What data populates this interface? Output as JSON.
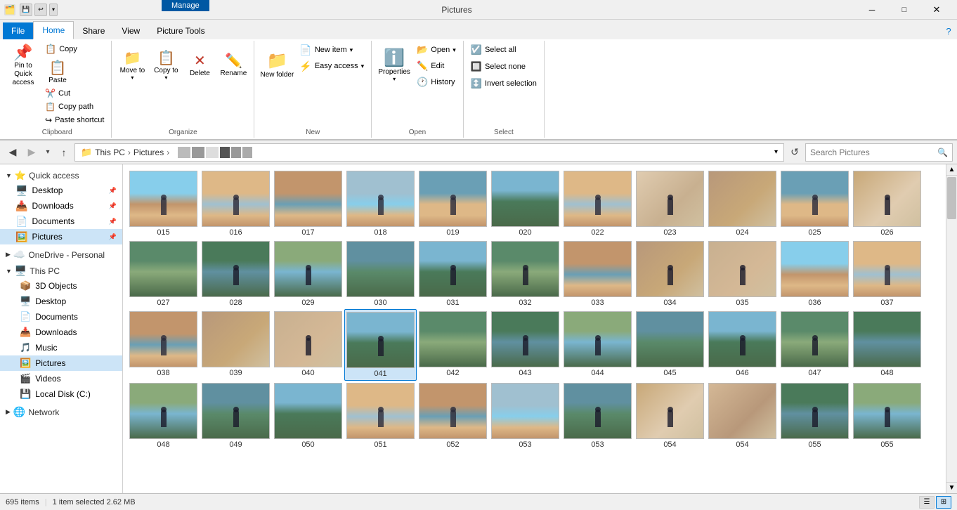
{
  "window": {
    "title": "Pictures",
    "manage_label": "Manage"
  },
  "titlebar": {
    "quicksave_label": "💾",
    "undo_label": "↩",
    "dropdown_label": "▾"
  },
  "ribbon": {
    "tabs": [
      "File",
      "Home",
      "Share",
      "View",
      "Picture Tools"
    ],
    "active_tab": "Home",
    "manage_tab": "Manage",
    "groups": {
      "clipboard": {
        "label": "Clipboard",
        "pin_label": "Pin to Quick access",
        "copy_label": "Copy",
        "paste_label": "Paste",
        "cut_label": "Cut",
        "copy_path_label": "Copy path",
        "paste_shortcut_label": "Paste shortcut"
      },
      "organize": {
        "label": "Organize",
        "move_to_label": "Move to",
        "copy_to_label": "Copy to",
        "delete_label": "Delete",
        "rename_label": "Rename"
      },
      "new": {
        "label": "New",
        "new_folder_label": "New folder",
        "new_item_label": "New item",
        "easy_access_label": "Easy access"
      },
      "open": {
        "label": "Open",
        "properties_label": "Properties",
        "open_label": "Open",
        "edit_label": "Edit",
        "history_label": "History"
      },
      "select": {
        "label": "Select",
        "select_all_label": "Select all",
        "select_none_label": "Select none",
        "invert_label": "Invert selection"
      }
    }
  },
  "address": {
    "path_parts": [
      "This PC",
      "Pictures"
    ],
    "search_placeholder": "Search Pictures"
  },
  "sidebar": {
    "quick_access_label": "Quick access",
    "items_quick": [
      {
        "label": "Desktop",
        "icon": "📁",
        "pinned": true
      },
      {
        "label": "Downloads",
        "icon": "📥",
        "pinned": true
      },
      {
        "label": "Documents",
        "icon": "📄",
        "pinned": true
      },
      {
        "label": "Pictures",
        "icon": "🖼️",
        "pinned": true,
        "active": true
      }
    ],
    "onedrive_label": "OneDrive - Personal",
    "this_pc_label": "This PC",
    "items_pc": [
      {
        "label": "3D Objects",
        "icon": "📦"
      },
      {
        "label": "Desktop",
        "icon": "🖥️"
      },
      {
        "label": "Documents",
        "icon": "📄"
      },
      {
        "label": "Downloads",
        "icon": "📥"
      },
      {
        "label": "Music",
        "icon": "🎵"
      },
      {
        "label": "Pictures",
        "icon": "🖼️",
        "active": true
      },
      {
        "label": "Videos",
        "icon": "🎬"
      },
      {
        "label": "Local Disk (C:)",
        "icon": "💾"
      }
    ],
    "network_label": "Network",
    "network_icon": "🌐"
  },
  "thumbnails": [
    {
      "id": "015",
      "type": "beach"
    },
    {
      "id": "016",
      "type": "beach"
    },
    {
      "id": "017",
      "type": "beach"
    },
    {
      "id": "018",
      "type": "beach"
    },
    {
      "id": "019",
      "type": "beach"
    },
    {
      "id": "020",
      "type": "outdoor"
    },
    {
      "id": "022",
      "type": "beach"
    },
    {
      "id": "023",
      "type": "indoor"
    },
    {
      "id": "024",
      "type": "indoor"
    },
    {
      "id": "025",
      "type": "beach"
    },
    {
      "id": "026",
      "type": "indoor"
    },
    {
      "id": "027",
      "type": "outdoor"
    },
    {
      "id": "028",
      "type": "outdoor"
    },
    {
      "id": "029",
      "type": "outdoor"
    },
    {
      "id": "030",
      "type": "outdoor"
    },
    {
      "id": "031",
      "type": "outdoor"
    },
    {
      "id": "032",
      "type": "outdoor"
    },
    {
      "id": "033",
      "type": "beach"
    },
    {
      "id": "034",
      "type": "indoor"
    },
    {
      "id": "035",
      "type": "indoor"
    },
    {
      "id": "036",
      "type": "beach"
    },
    {
      "id": "037",
      "type": "beach"
    },
    {
      "id": "038",
      "type": "beach"
    },
    {
      "id": "039",
      "type": "indoor"
    },
    {
      "id": "040",
      "type": "indoor"
    },
    {
      "id": "041",
      "type": "outdoor",
      "selected": true
    },
    {
      "id": "042",
      "type": "outdoor"
    },
    {
      "id": "043",
      "type": "outdoor"
    },
    {
      "id": "044",
      "type": "outdoor"
    },
    {
      "id": "045",
      "type": "outdoor"
    },
    {
      "id": "046",
      "type": "outdoor"
    },
    {
      "id": "047",
      "type": "outdoor"
    },
    {
      "id": "048",
      "type": "outdoor"
    },
    {
      "id": "048b",
      "type": "outdoor",
      "label": "048"
    },
    {
      "id": "049",
      "type": "outdoor"
    },
    {
      "id": "050",
      "type": "outdoor"
    },
    {
      "id": "051",
      "type": "beach"
    },
    {
      "id": "052",
      "type": "beach"
    },
    {
      "id": "053",
      "type": "beach"
    },
    {
      "id": "053b",
      "type": "outdoor",
      "label": "053"
    },
    {
      "id": "054",
      "type": "indoor"
    },
    {
      "id": "054b",
      "type": "indoor",
      "label": "054"
    },
    {
      "id": "055",
      "type": "outdoor"
    },
    {
      "id": "055b",
      "type": "outdoor",
      "label": "055"
    }
  ],
  "status": {
    "item_count": "695 items",
    "selected": "1 item selected  2.62 MB"
  },
  "colors": {
    "accent": "#0078d4",
    "selected_bg": "#cce4f7",
    "ribbon_bg": "#f0f0f0",
    "manage_bg": "#0058a3"
  }
}
